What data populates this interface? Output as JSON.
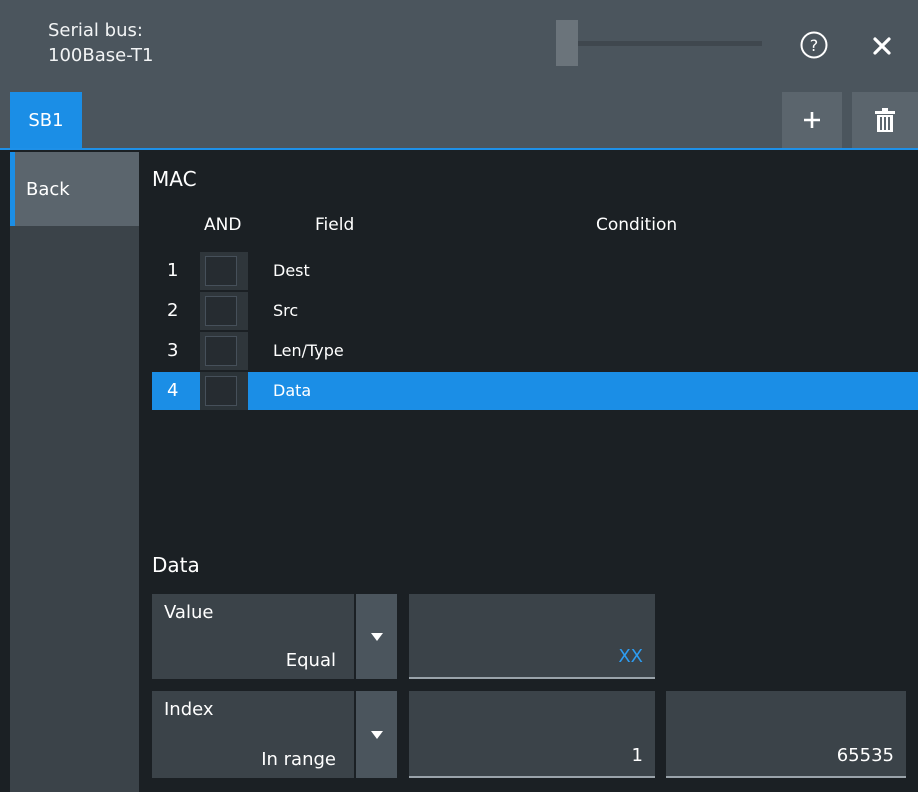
{
  "titlebar": {
    "title_line1": "Serial bus:",
    "title_line2": "100Base-T1"
  },
  "tabs": {
    "active": "SB1"
  },
  "nav": {
    "back_label": "Back"
  },
  "mac": {
    "title": "MAC",
    "headers": {
      "and": "AND",
      "field": "Field",
      "condition": "Condition"
    },
    "rows": [
      {
        "num": "1",
        "field": "Dest",
        "checked": false,
        "selected": false
      },
      {
        "num": "2",
        "field": "Src",
        "checked": false,
        "selected": false
      },
      {
        "num": "3",
        "field": "Len/Type",
        "checked": false,
        "selected": false
      },
      {
        "num": "4",
        "field": "Data",
        "checked": false,
        "selected": true
      }
    ]
  },
  "data": {
    "title": "Data",
    "value": {
      "label": "Value",
      "selected": "Equal",
      "field": "XX"
    },
    "index": {
      "label": "Index",
      "selected": "In range",
      "min": "1",
      "max": "65535"
    }
  },
  "colors": {
    "accent": "#1b8ee6",
    "xx_value": "#2d9cf0"
  },
  "icons": [
    "help-icon",
    "close-icon",
    "plus-icon",
    "trash-icon",
    "dropdown-arrow-icon"
  ]
}
